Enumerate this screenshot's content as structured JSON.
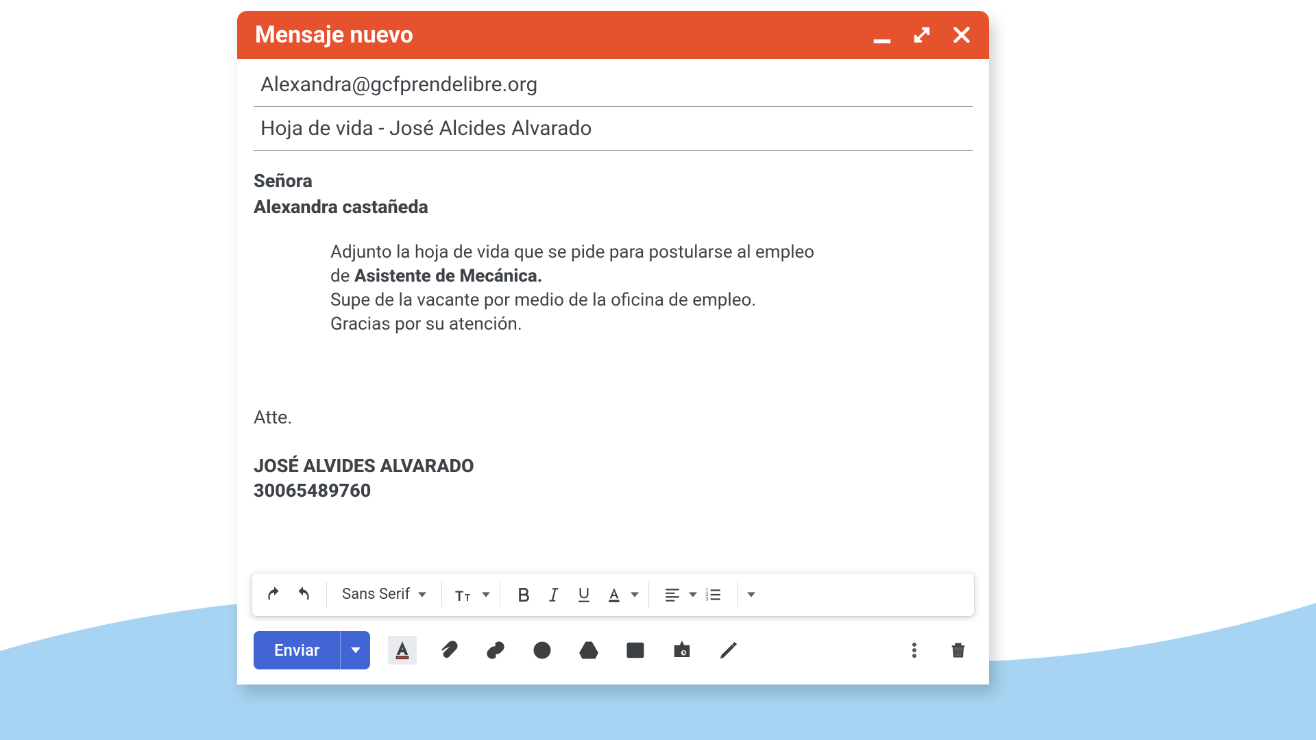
{
  "header": {
    "title": "Mensaje nuevo"
  },
  "fields": {
    "to": "Alexandra@gcfprendelibre.org",
    "subject": "Hoja de vida - José Alcides Alvarado"
  },
  "body": {
    "greeting_title": "Señora",
    "greeting_name": "Alexandra castañeda",
    "para_before": "Adjunto la hoja de vida que se pide para postularse al empleo de ",
    "para_bold": "Asistente de Mecánica.",
    "para_line2": "Supe de la vacante por medio de la oficina de empleo.",
    "para_line3": "Gracias por su atención.",
    "closing": "Atte.",
    "signature_name": "JOSÉ ALVIDES ALVARADO",
    "signature_phone": "30065489760"
  },
  "toolbar": {
    "font_family": "Sans Serif",
    "send_label": "Enviar"
  },
  "icons": {
    "minimize": "minimize-icon",
    "fullscreen": "double-arrow-icon",
    "close": "close-icon"
  }
}
